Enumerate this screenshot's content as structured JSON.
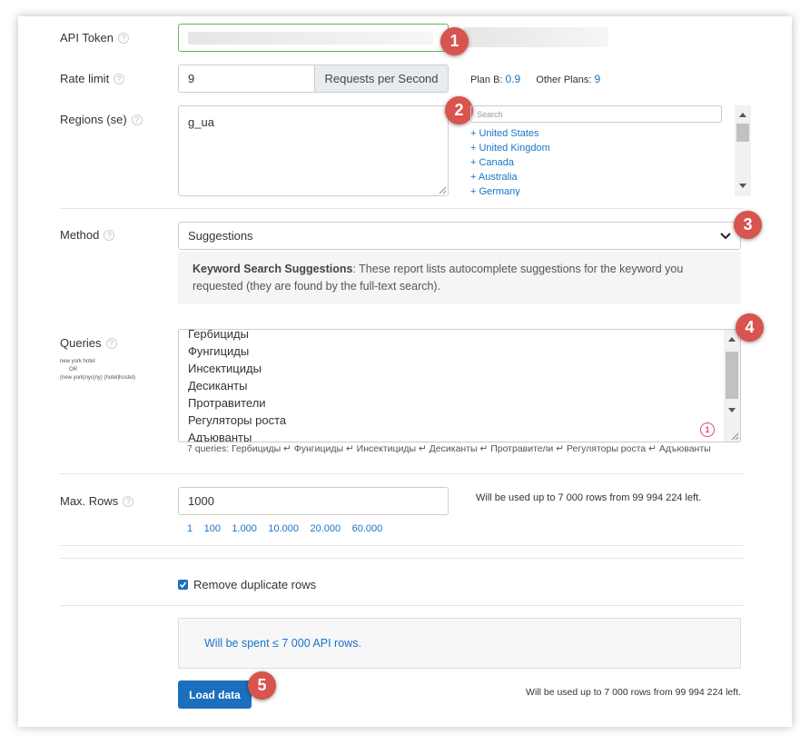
{
  "api_token": {
    "label": "API Token",
    "help": "?"
  },
  "rate_limit": {
    "label": "Rate limit",
    "help": "?",
    "value": "9",
    "unit": "Requests per Second",
    "plan_b_label": "Plan B:",
    "plan_b_value": "0.9",
    "other_label": "Other Plans:",
    "other_value": "9"
  },
  "regions": {
    "label": "Regions (se)",
    "help": "?",
    "value": "g_ua",
    "search_placeholder": "Search",
    "items": [
      "+ United States",
      "+ United Kingdom",
      "+ Canada",
      "+ Australia",
      "+ Germany"
    ]
  },
  "method": {
    "label": "Method",
    "help": "?",
    "selected": "Suggestions",
    "desc_title": "Keyword Search Suggestions",
    "desc_text": ": These report lists autocomplete suggestions for the keyword you requested (they are found by the full-text search)."
  },
  "queries": {
    "label": "Queries",
    "help": "?",
    "hint_1": "new york hotel",
    "hint_2": "OR",
    "hint_3": "(new york|nyc|ny) (hotel|hostel)",
    "lines": [
      "Гербициды",
      "Фунгициды",
      "Инсектициды",
      "Десиканты",
      "Протравители",
      "Регуляторы роста",
      "Адъюванты"
    ],
    "counter": "1",
    "summary": "7 queries: Гербициды ↵ Фунгициды ↵ Инсектициды ↵ Десиканты ↵ Протравители ↵ Регуляторы роста ↵ Адъюванты"
  },
  "max_rows": {
    "label": "Max. Rows",
    "help": "?",
    "value": "1000",
    "info": "Will be used up to 7 000 rows from 99 994 224 left.",
    "presets": [
      "1",
      "100",
      "1.000",
      "10.000",
      "20.000",
      "60.000"
    ]
  },
  "dedupe": {
    "label": "Remove duplicate rows",
    "checked": true
  },
  "summary": {
    "spent": "Will be spent ≤ 7 000 API rows."
  },
  "load": {
    "button": "Load data",
    "info": "Will be used up to 7 000 rows from 99 994 224 left."
  },
  "badges": [
    "1",
    "2",
    "3",
    "4",
    "5"
  ],
  "colors": {
    "accent": "#1c6fbd",
    "link": "#1a73c8",
    "badge": "#d9534f",
    "token_border": "#5cb85c"
  }
}
